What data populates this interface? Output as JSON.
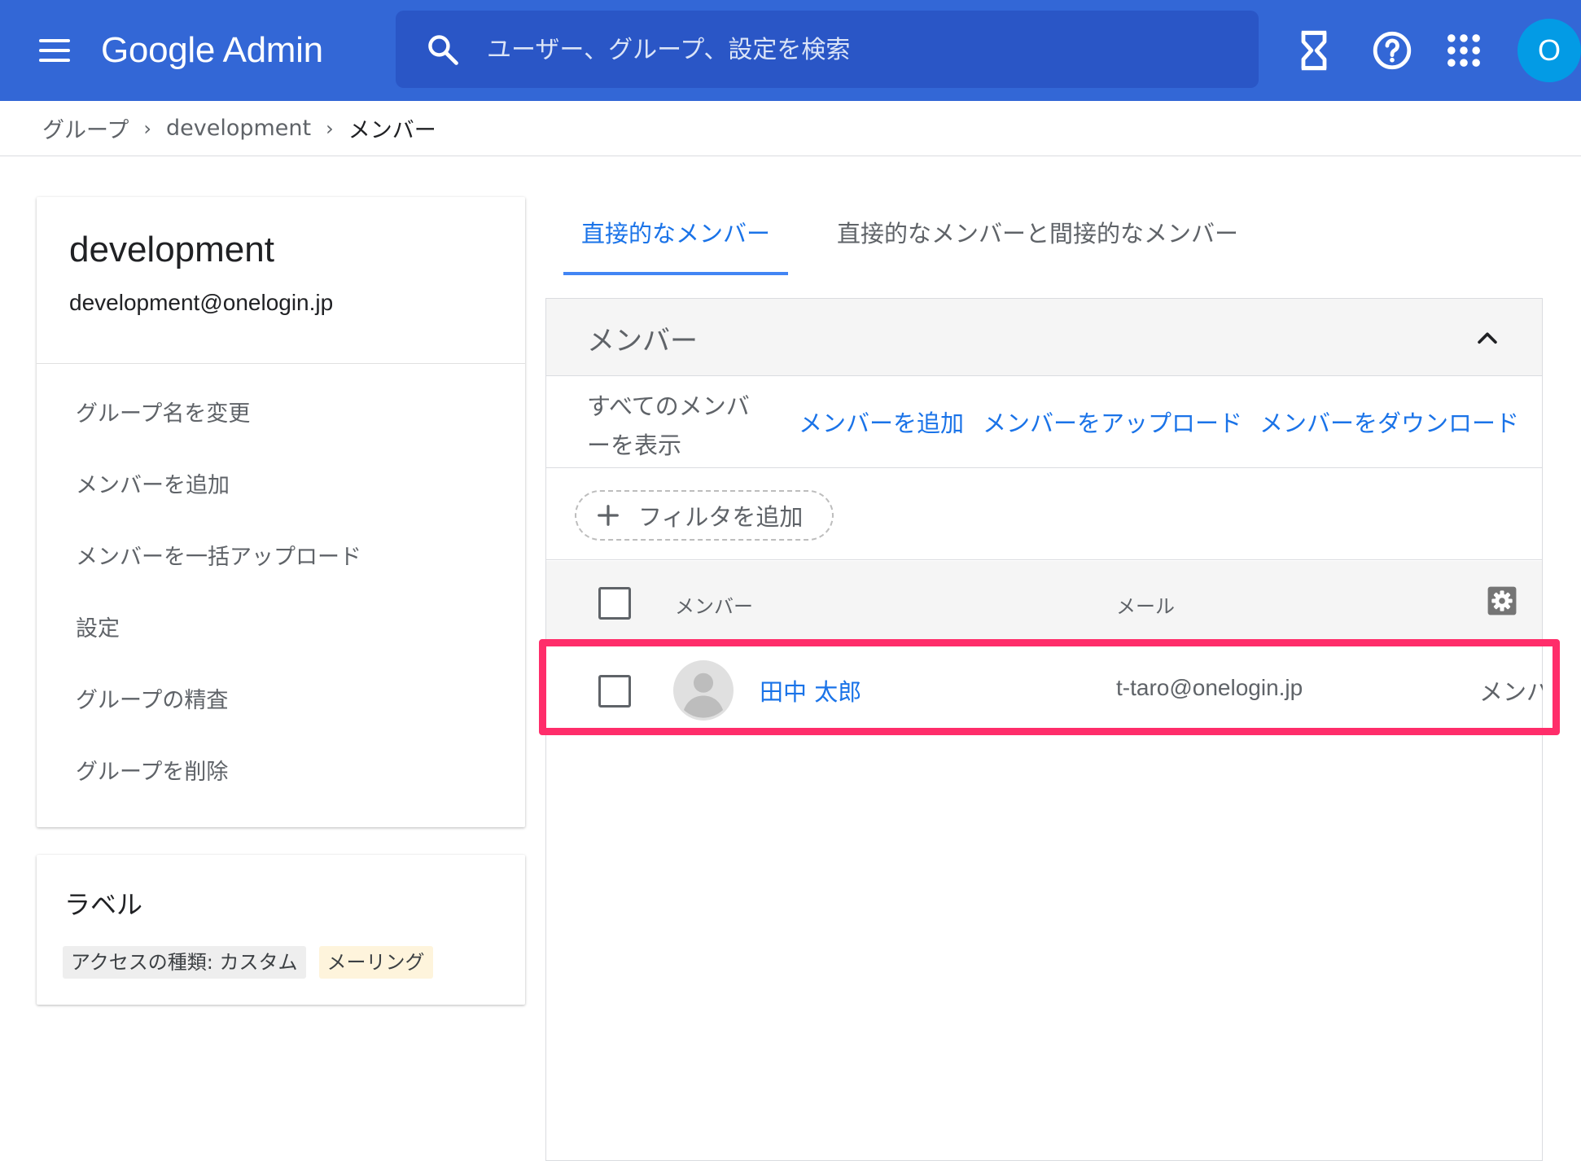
{
  "app": {
    "logo_text": "Google Admin",
    "search_placeholder": "ユーザー、グループ、設定を検索",
    "account_initial": "O"
  },
  "icons": {
    "menu": "hamburger-menu-icon",
    "search": "search-icon",
    "tasks": "hourglass-icon",
    "help": "help-circle-icon",
    "apps": "apps-grid-icon",
    "collapse": "chevron-up-icon",
    "add_filter": "plus-icon",
    "columns": "gear-icon",
    "avatar": "default-avatar-icon"
  },
  "breadcrumb": {
    "items": [
      "グループ",
      "development",
      "メンバー"
    ]
  },
  "group": {
    "name": "development",
    "email": "development@onelogin.jp",
    "actions": [
      "グループ名を変更",
      "メンバーを追加",
      "メンバーを一括アップロード",
      "設定",
      "グループの精査",
      "グループを削除"
    ]
  },
  "labels": {
    "title": "ラベル",
    "chips": [
      {
        "text": "アクセスの種類: カスタム",
        "bg": "#eeeeee",
        "color": "#3c4043"
      },
      {
        "text": "メーリング",
        "bg": "#fef4dc",
        "color": "#3c4043"
      }
    ]
  },
  "tabs": [
    {
      "label": "直接的なメンバー",
      "active": true
    },
    {
      "label": "直接的なメンバーと間接的なメンバー",
      "active": false
    }
  ],
  "members_panel": {
    "title": "メンバー",
    "show_all": "すべてのメンバーを表示",
    "actions": [
      "メンバーを追加",
      "メンバーをアップロード",
      "メンバーをダウンロード"
    ],
    "add_filter": "フィルタを追加",
    "columns": [
      "メンバー",
      "メール"
    ],
    "rows": [
      {
        "name": "田中 太郎",
        "email": "t-taro@onelogin.jp",
        "role": "メンバー"
      }
    ]
  },
  "colors": {
    "header_bg": "#3367d6",
    "search_bg": "#2a56c6",
    "link": "#1a73e8",
    "tab_indicator": "#4285f4",
    "avatar_bg": "#039be5",
    "highlight": "#ff2d6a"
  }
}
